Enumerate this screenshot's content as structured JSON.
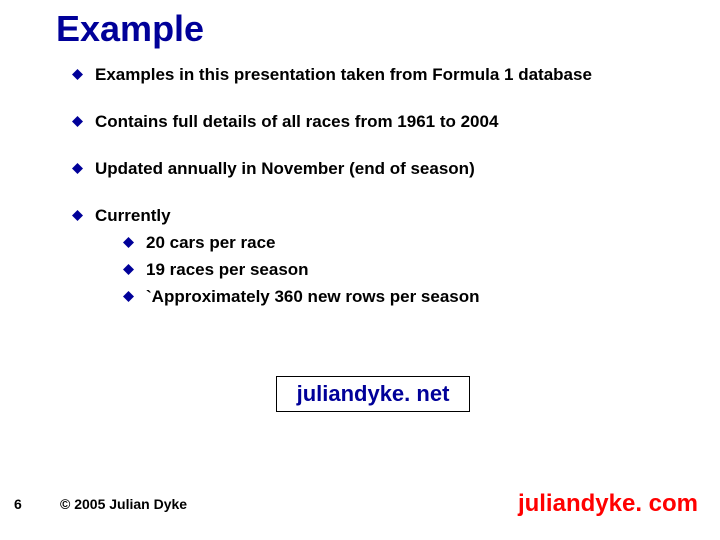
{
  "slide": {
    "title": "Example",
    "bullets": [
      {
        "text": "Examples in this presentation taken from Formula 1 database"
      },
      {
        "text": "Contains full details of all races from 1961 to 2004"
      },
      {
        "text": "Updated annually in November (end of season)"
      },
      {
        "text": "Currently",
        "sub": [
          "20 cars per race",
          "19 races per season",
          "`Approximately 360 new rows per season"
        ]
      }
    ],
    "box": "juliandyke. net",
    "page_number": "6",
    "copyright": "© 2005 Julian Dyke",
    "footer_site": "juliandyke. com"
  },
  "colors": {
    "title": "#000099",
    "bullet": "#000099",
    "footer_site": "#ff0000"
  }
}
